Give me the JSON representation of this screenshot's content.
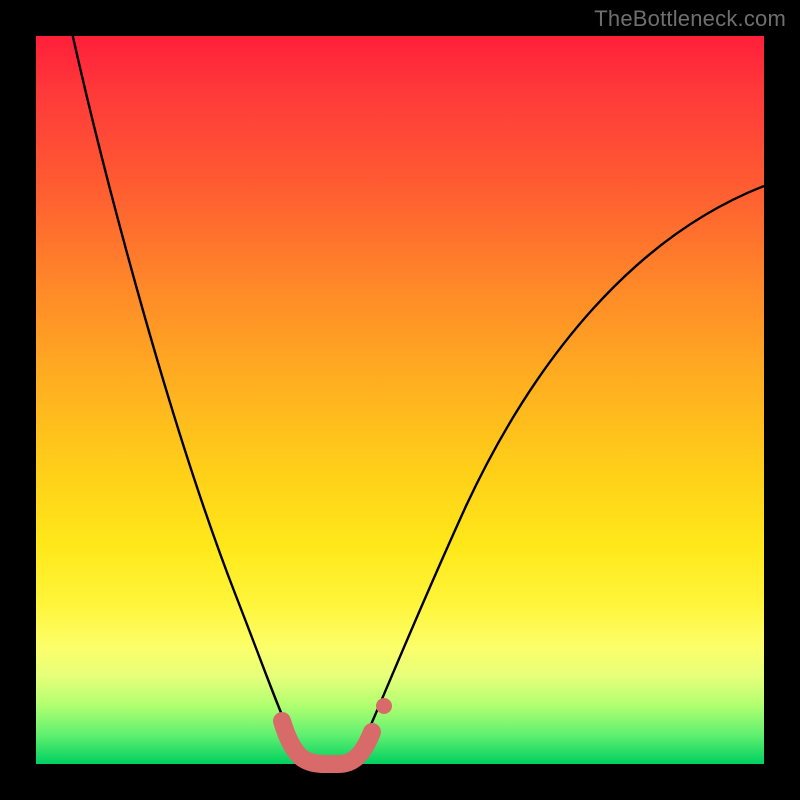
{
  "watermark": "TheBottleneck.com",
  "colors": {
    "gradient_top": "#ff1f3a",
    "gradient_bottom": "#00d060",
    "curve": "#000000",
    "highlight": "#d96a6a",
    "frame": "#000000",
    "watermark_text": "#6f6f6f"
  },
  "chart_data": {
    "type": "line",
    "title": "",
    "xlabel": "",
    "ylabel": "",
    "xlim": [
      0,
      100
    ],
    "ylim": [
      0,
      100
    ],
    "grid": false,
    "legend": false,
    "annotations": [
      "TheBottleneck.com"
    ],
    "series": [
      {
        "name": "bottleneck-curve",
        "color": "#000000",
        "x": [
          4,
          8,
          12,
          16,
          20,
          24,
          28,
          32,
          35,
          37,
          39,
          41,
          43,
          45,
          48,
          52,
          58,
          66,
          76,
          88,
          100
        ],
        "values": [
          105,
          95,
          84,
          72,
          60,
          48,
          35,
          22,
          12,
          6,
          2,
          0,
          0,
          2,
          8,
          20,
          38,
          56,
          70,
          78,
          80
        ]
      },
      {
        "name": "trough-highlight",
        "color": "#d96a6a",
        "style": "thick-round",
        "x": [
          34,
          36,
          38,
          40,
          42,
          44,
          46
        ],
        "values": [
          6,
          3,
          1,
          0,
          0,
          1,
          4
        ]
      },
      {
        "name": "marker-dot",
        "color": "#d96a6a",
        "style": "point",
        "x": [
          48
        ],
        "values": [
          8
        ]
      }
    ],
    "background": {
      "type": "vertical-gradient",
      "stops": [
        {
          "pos": 0.0,
          "color": "#ff1f3a"
        },
        {
          "pos": 0.2,
          "color": "#ff5a32"
        },
        {
          "pos": 0.48,
          "color": "#ffb020"
        },
        {
          "pos": 0.7,
          "color": "#ffe81a"
        },
        {
          "pos": 0.88,
          "color": "#e6ff7a"
        },
        {
          "pos": 1.0,
          "color": "#00d060"
        }
      ]
    }
  }
}
